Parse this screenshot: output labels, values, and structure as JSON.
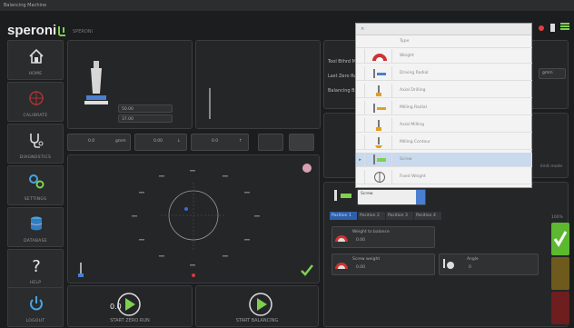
{
  "window": {
    "title": "Balancing Machine"
  },
  "brand": {
    "name": "speroni",
    "subtitle": "SPERONI"
  },
  "sidebar": {
    "items": [
      {
        "label": "HOME",
        "icon": "home-icon"
      },
      {
        "label": "CALIBRATE",
        "icon": "target-icon"
      },
      {
        "label": "DIAGNOSTICS",
        "icon": "stethoscope-icon"
      },
      {
        "label": "SETTINGS",
        "icon": "gears-icon"
      },
      {
        "label": "DATABASE",
        "icon": "database-icon"
      },
      {
        "label": "HELP",
        "icon": "question-icon"
      },
      {
        "label": "LOGOUT",
        "icon": "power-icon"
      }
    ]
  },
  "tool_panel": {
    "value1": "50.00",
    "value2": "37.00"
  },
  "params": [
    {
      "value": "0.0",
      "unit": "gmm"
    },
    {
      "value": "0.00",
      "unit": "↓"
    },
    {
      "value": "0.0",
      "unit": "↑"
    }
  ],
  "info": {
    "line1": "Tool Bthrd Mc",
    "line2": "Last Zero Run",
    "line3": "Balancing Bal",
    "unit": "gmm",
    "side_note": "limit mode"
  },
  "dialog": {
    "close": "×",
    "column_type": "Type",
    "rows": [
      {
        "label": "Weight",
        "icon": "weight-icon",
        "selected": false,
        "marker": ""
      },
      {
        "label": "Driving Radial",
        "icon": "radial-drill-icon",
        "selected": false,
        "marker": ""
      },
      {
        "label": "Axial Drilling",
        "icon": "axial-drill-icon",
        "selected": false,
        "marker": ""
      },
      {
        "label": "Milling Radial",
        "icon": "radial-mill-icon",
        "selected": false,
        "marker": ""
      },
      {
        "label": "Axial Milling",
        "icon": "axial-mill-icon",
        "selected": false,
        "marker": ""
      },
      {
        "label": "Milling Contour",
        "icon": "contour-mill-icon",
        "selected": false,
        "marker": ""
      },
      {
        "label": "Screw",
        "icon": "screw-icon",
        "selected": true,
        "marker": "▸"
      },
      {
        "label": "Fixed Weight",
        "icon": "fixed-weight-icon",
        "selected": false,
        "marker": ""
      }
    ]
  },
  "correction": {
    "type_value": "Screw",
    "tabs": [
      "Position 1",
      "Position 2",
      "Position 3",
      "Position 4"
    ],
    "weight_label": "Weight to balance",
    "weight_value": "0.00",
    "screw_label": "Screw weight",
    "screw_value": "0.00",
    "angle_label": "Angle",
    "angle_value": "0",
    "percent": "100%"
  },
  "buttons": {
    "start_zero": "START ZERO RUN",
    "start_zero_value": "0.0",
    "start_balancing": "START BALANCING"
  },
  "colors": {
    "accent": "#7fd04f",
    "ok": "#5cb82e",
    "warn": "#6e5a1d",
    "err": "#6e1e1e"
  }
}
